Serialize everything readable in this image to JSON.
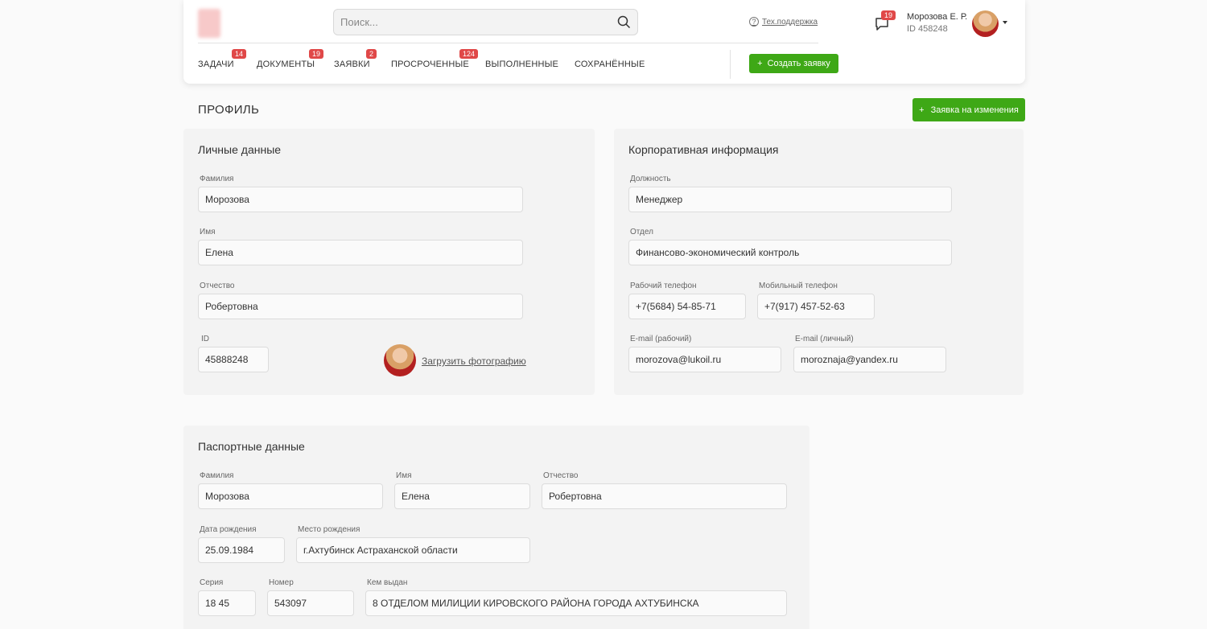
{
  "header": {
    "search_placeholder": "Поиск...",
    "support": "Тех.поддержка",
    "messages_count": "19",
    "user_name": "Морозова Е. Р.",
    "user_id": "ID 458248",
    "create_button": "Создать заявку"
  },
  "nav": [
    {
      "label": "ЗАДАЧИ",
      "badge": "14"
    },
    {
      "label": "ДОКУМЕНТЫ",
      "badge": "19"
    },
    {
      "label": "ЗАЯВКИ",
      "badge": "2"
    },
    {
      "label": "ПРОСРОЧЕННЫЕ",
      "badge": "124"
    },
    {
      "label": "ВЫПОЛНЕННЫЕ",
      "badge": ""
    },
    {
      "label": "СОХРАНЁННЫЕ",
      "badge": ""
    }
  ],
  "page": {
    "title": "ПРОФИЛЬ",
    "change_button": "Заявка на изменения"
  },
  "personal": {
    "title": "Личные данные",
    "surname_label": "Фамилия",
    "surname": "Морозова",
    "name_label": "Имя",
    "name": "Елена",
    "patronymic_label": "Отчество",
    "patronymic": "Робертовна",
    "id_label": "ID",
    "id": "45888248",
    "upload_photo": "Загрузить фотографию"
  },
  "corporate": {
    "title": "Корпоративная информация",
    "position_label": "Должность",
    "position": "Менеджер",
    "department_label": "Отдел",
    "department": "Финансово-экономический контроль",
    "work_phone_label": "Рабочий телефон",
    "work_phone": "+7(5684) 54-85-71",
    "mobile_phone_label": "Мобильный телефон",
    "mobile_phone": "+7(917) 457-52-63",
    "work_email_label": "E-mail (рабочий)",
    "work_email": "morozova@lukoil.ru",
    "personal_email_label": "E-mail (личный)",
    "personal_email": "moroznaja@yandex.ru"
  },
  "passport": {
    "title": "Паспортные данные",
    "surname_label": "Фамилия",
    "surname": "Морозова",
    "name_label": "Имя",
    "name": "Елена",
    "patronymic_label": "Отчество",
    "patronymic": "Робертовна",
    "birth_date_label": "Дата рождения",
    "birth_date": "25.09.1984",
    "birth_place_label": "Место рождения",
    "birth_place": "г.Ахтубинск Астраханской области",
    "series_label": "Серия",
    "series": "18 45",
    "number_label": "Номер",
    "number": "543097",
    "issued_by_label": "Кем выдан",
    "issued_by": "8 ОТДЕЛОМ МИЛИЦИИ КИРОВСКОГО РАЙОНА ГОРОДА АХТУБИНСКА"
  },
  "colors": {
    "accent": "#3ea816",
    "badge": "#e04848"
  }
}
